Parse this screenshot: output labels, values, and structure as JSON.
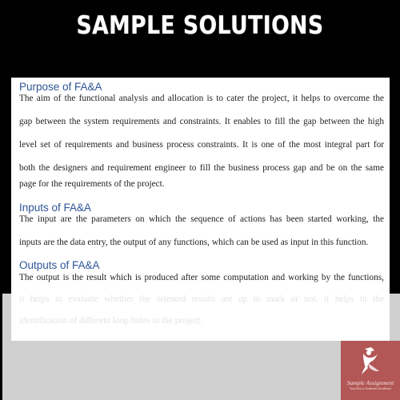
{
  "banner": {
    "title": "SAMPLE SOLUTIONS"
  },
  "document": {
    "sections": [
      {
        "heading": "Purpose of FA&A",
        "lines": [
          "The aim of the functional analysis and allocation is to cater the project, it helps to overcome the",
          "gap between the system requirements and constraints. It enables to fill the gap between the high",
          "level set of requirements and business process constraints. It is one of the most integral part for",
          "both the designers and requirement engineer to fill the business process gap and be on the same",
          "page for the requirements of the project."
        ]
      },
      {
        "heading": "Inputs of FA&A",
        "lines": [
          "The input are the parameters on which the sequence of actions has been started working, the",
          "inputs are the data entry, the output of any functions, which can be used as input in this function."
        ]
      },
      {
        "heading": "Outputs of FA&A",
        "lines": [
          "The output is the result which is produced after some computation and working by the functions,",
          "it helps to evaluate whether the oriented results are up to mark or not. it helps in the",
          "identification of different loop holes in the project."
        ]
      }
    ]
  },
  "logo": {
    "icon": "dancing-figure-icon",
    "name": "Sample Assignment",
    "tagline": "Your Key to Academic Excellence",
    "color": "#b25656"
  },
  "colors": {
    "heading": "#2f5597",
    "body_text": "#222222",
    "faded_text": "#e3e3e3",
    "top_background": "#000000",
    "bottom_background": "#d0d0d0"
  }
}
